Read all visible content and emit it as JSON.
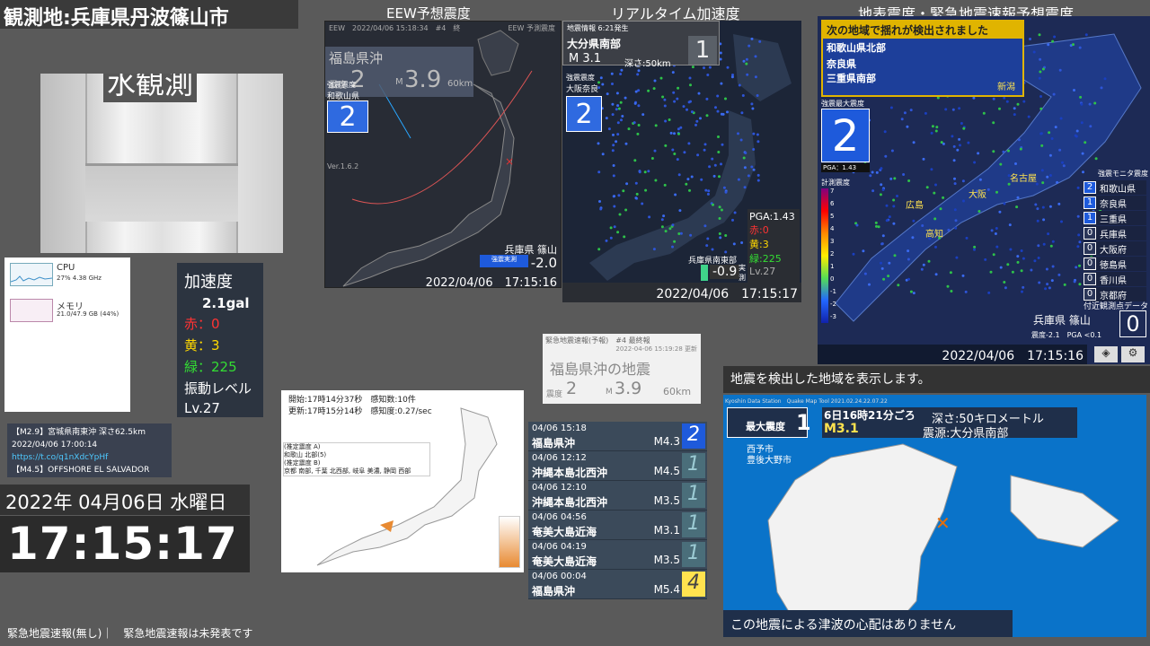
{
  "header": {
    "title": "観測地:兵庫県丹波篠山市"
  },
  "titles": {
    "eew": "EEW予想震度",
    "realtime": "リアルタイム加速度",
    "ground": "地表震度・緊急地震速報予想震度"
  },
  "water": {
    "label": "水観測"
  },
  "sysmon": {
    "cpu_label": "CPU",
    "cpu_value": "27% 4.38 GHz",
    "mem_label": "メモリ",
    "mem_value": "21.0/47.9 GB (44%)"
  },
  "accel": {
    "title": "加速度",
    "value": "2.1gal",
    "red": "赤：0",
    "yellow": "黄：3",
    "green": "緑：225",
    "vib": "振動レベル",
    "level": "Lv.27"
  },
  "tweet": {
    "line1": "【M2.9】宮城県南東沖 深さ62.5km",
    "line2": "2022/04/06 17:00:14",
    "line3": "https://t.co/q1nXdcYpHf",
    "line4": "【M4.5】OFFSHORE EL SALVADOR"
  },
  "date": {
    "text": "2022年 04月06日 水曜日"
  },
  "clock": {
    "time": "17:15:17"
  },
  "footer": {
    "text": "緊急地震速報(無し)｜　緊急地震速報は未発表です"
  },
  "eew": {
    "header": "EEW　2022/04/06 15:18:34　#4　終",
    "app": "EEW 予測震度",
    "epicenter": "福島県沖",
    "int_label": "震度",
    "int": "2",
    "m_label": "M",
    "mag": "3.9",
    "depth": "60km",
    "strong_label": "強震震度",
    "region": "和歌山県",
    "region_int": "2",
    "version": "Ver.1.6.2",
    "obs_label": "強震実測",
    "obs_place": "兵庫県 篠山",
    "obs_value": "-2.0",
    "timestamp": "2022/04/06　17:15:16"
  },
  "realtime": {
    "info_label": "地震情報 6:21発生",
    "epicenter": "大分県南部",
    "mag": "M 3.1",
    "depth": "深さ:50km",
    "int": "1",
    "strong_label": "強震震度",
    "region": "大阪奈良",
    "region_int": "2",
    "pga": "PGA:1.43",
    "red": "赤:0",
    "yellow": "黄:3",
    "green": "緑:225",
    "lv": "Lv.27",
    "obs_place": "兵庫県南東部",
    "obs_value": "-0.9",
    "obs_tag": "実測",
    "timestamp": "2022/04/06　17:15:17"
  },
  "ground": {
    "alert": "次の地域で揺れが検出されました",
    "regions": [
      "和歌山県北部",
      "奈良県",
      "三重県南部"
    ],
    "max_label": "強震最大震度",
    "max": "2",
    "pga": "PGA：1.43",
    "scale_label": "計測震度",
    "scale": [
      "7",
      "6",
      "5",
      "4",
      "3",
      "2",
      "1",
      "0",
      "-1",
      "-2",
      "-3"
    ],
    "monitor_label": "強震モニタ震度",
    "prefs": [
      {
        "int": "2",
        "name": "和歌山県"
      },
      {
        "int": "1",
        "name": "奈良県"
      },
      {
        "int": "1",
        "name": "三重県"
      },
      {
        "int": "0",
        "name": "兵庫県"
      },
      {
        "int": "0",
        "name": "大阪府"
      },
      {
        "int": "0",
        "name": "徳島県"
      },
      {
        "int": "0",
        "name": "香川県"
      },
      {
        "int": "0",
        "name": "京都府"
      }
    ],
    "near_label": "付近観測点データ",
    "obs_place": "兵庫県 篠山",
    "obs_int": "0",
    "obs_detail": "震度-2.1　PGA <0.1",
    "timestamp": "2022/04/06　17:15:16",
    "city_labels": [
      "新潟",
      "名古屋",
      "大阪",
      "広島",
      "高知"
    ]
  },
  "quake": {
    "banner": "地震を検出した地域を表示します。",
    "app": "Kyoshin Data Station　Quake Map Tool 2021.02.24.22.07.22",
    "max_label": "最大震度",
    "max": "1",
    "time": "6日16時21分ごろ",
    "depth": "深さ:50キロメートル",
    "mag": "M3.1",
    "source": "震源:大分県南部",
    "cities": [
      "西予市",
      "豊後大野市"
    ],
    "tsunami": "この地震による津波の心配はありません"
  },
  "eew_card": {
    "header": "緊急地震速報(予報)　#4 最終報",
    "updated": "2022-04-06 15:19:28 更新",
    "title": "福島県沖の地震",
    "int_label": "震度",
    "int": "2",
    "m_label": "M",
    "mag": "3.9",
    "depth": "60km"
  },
  "history": [
    {
      "date": "04/06 15:18",
      "place": "福島県沖",
      "mag": "M4.3",
      "int": "2"
    },
    {
      "date": "04/06 12:12",
      "place": "沖縄本島北西沖",
      "mag": "M4.5",
      "int": "1"
    },
    {
      "date": "04/06 12:10",
      "place": "沖縄本島北西沖",
      "mag": "M3.5",
      "int": "1"
    },
    {
      "date": "04/06 04:56",
      "place": "奄美大島近海",
      "mag": "M3.1",
      "int": "1"
    },
    {
      "date": "04/06 04:19",
      "place": "奄美大島近海",
      "mag": "M3.5",
      "int": "1"
    },
    {
      "date": "04/06 00:04",
      "place": "福島県沖",
      "mag": "M5.4",
      "int": "4"
    }
  ],
  "shake": {
    "start": "開始:17時14分37秒　感知数:10件",
    "update": "更新:17時15分14秒　感知度:0.27/sec",
    "notes": [
      "(推定震度 A)",
      "和歌山 北部(5)",
      "(推定震度 B)",
      "京都 南部, 千葉 北西部, 岐阜 美濃, 静岡 西部"
    ]
  }
}
